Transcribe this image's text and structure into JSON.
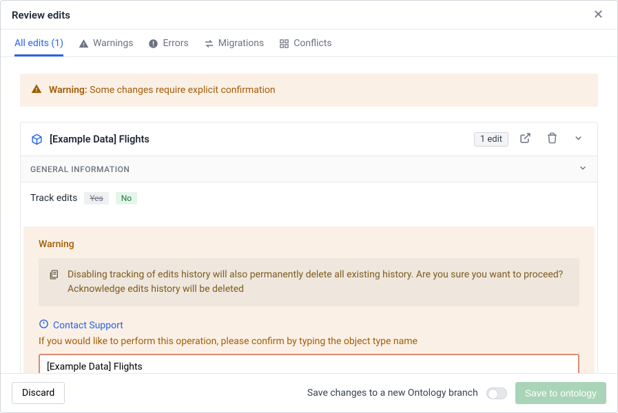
{
  "header": {
    "title": "Review edits"
  },
  "tabs": {
    "all_edits": "All edits (1)",
    "warnings": "Warnings",
    "errors": "Errors",
    "migrations": "Migrations",
    "conflicts": "Conflicts"
  },
  "banner": {
    "prefix": "Warning:",
    "text": " Some changes require explicit confirmation"
  },
  "object": {
    "title": "[Example Data] Flights",
    "edit_badge": "1 edit",
    "section_label": "GENERAL INFORMATION",
    "track_label": "Track edits",
    "opt_yes": "Yes",
    "opt_no": "No"
  },
  "warning_box": {
    "title": "Warning",
    "msg_line1": "Disabling tracking of edits history will also permanently delete all existing history. Are you sure you want to proceed?",
    "msg_line2": "Acknowledge edits history will be deleted",
    "support": "Contact Support",
    "confirm_text": "If you would like to perform this operation, please confirm by typing the object type name",
    "input_value": "[Example Data] Flights"
  },
  "footer": {
    "discard": "Discard",
    "branch_text": "Save changes to a new Ontology branch",
    "save": "Save to ontology"
  }
}
